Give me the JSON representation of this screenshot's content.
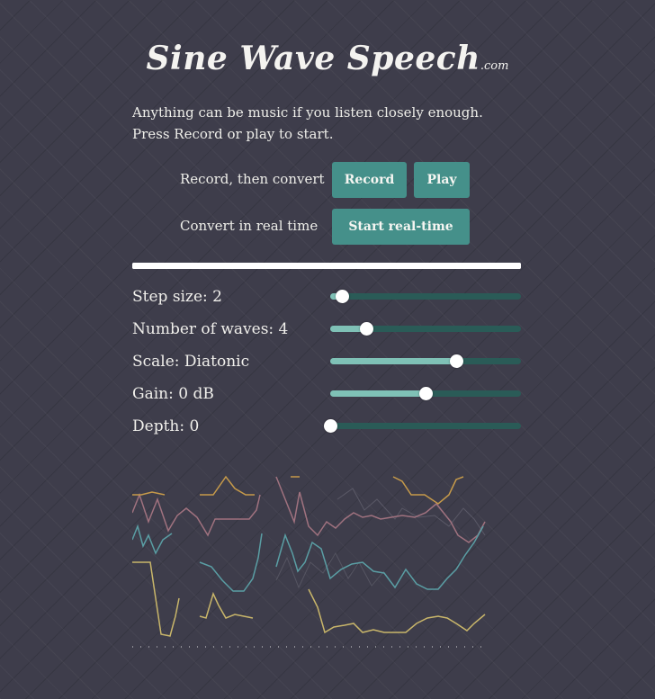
{
  "header": {
    "title": "Sine Wave Speech",
    "suffix": ".com"
  },
  "intro": "Anything can be music if you listen closely enough. Press Record or play to start.",
  "controls": {
    "record_row_label": "Record, then convert",
    "record_button": "Record",
    "play_button": "Play",
    "realtime_row_label": "Convert in real time",
    "realtime_button": "Start real-time"
  },
  "progress": {
    "fraction": 1.0
  },
  "sliders": [
    {
      "label": "Step size: 2",
      "fraction": 0.06
    },
    {
      "label": "Number of waves: 4",
      "fraction": 0.19
    },
    {
      "label": "Scale: Diatonic",
      "fraction": 0.66
    },
    {
      "label": "Gain: 0 dB",
      "fraction": 0.5
    },
    {
      "label": "Depth: 0",
      "fraction": 0.0
    }
  ],
  "colors": {
    "background": "#3e3d4b",
    "button": "#45908a",
    "slider_track": "#2a5b57",
    "slider_fill": "#7fc1b6",
    "wave_colors": [
      "#c9b66a",
      "#5a9ea4",
      "#a0727f",
      "#c69a4a",
      "#9b8aa0"
    ]
  }
}
